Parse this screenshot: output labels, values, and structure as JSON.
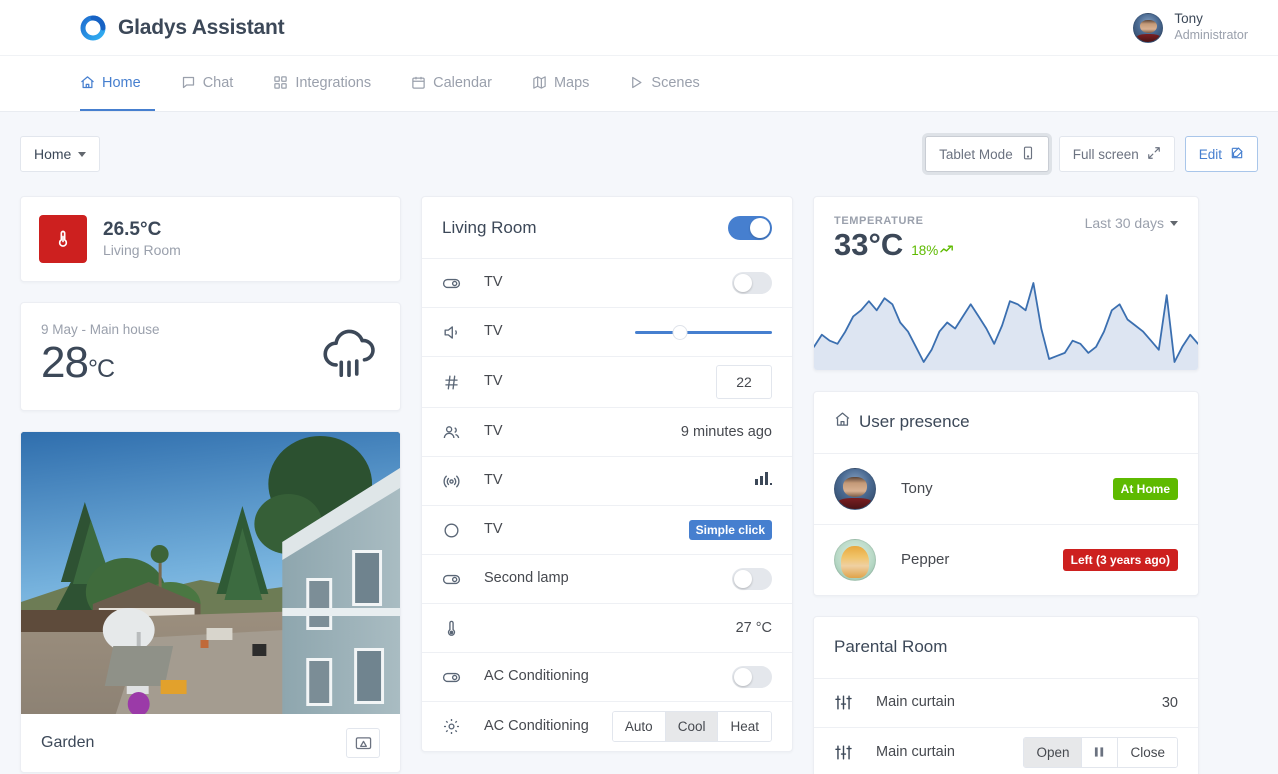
{
  "app": {
    "brand": "Gladys Assistant",
    "logo_icon": "gladys-logo-icon",
    "accent": "#467fcf",
    "danger": "#cd201f",
    "success": "#5eba00"
  },
  "user": {
    "name": "Tony",
    "role": "Administrator",
    "avatar_icon": "avatar-tony"
  },
  "nav": {
    "items": [
      {
        "label": "Home",
        "icon": "home-icon",
        "active": true
      },
      {
        "label": "Chat",
        "icon": "chat-icon",
        "active": false
      },
      {
        "label": "Integrations",
        "icon": "grid-icon",
        "active": false
      },
      {
        "label": "Calendar",
        "icon": "calendar-icon",
        "active": false
      },
      {
        "label": "Maps",
        "icon": "map-icon",
        "active": false
      },
      {
        "label": "Scenes",
        "icon": "play-icon",
        "active": false
      }
    ]
  },
  "toolbar": {
    "dashboard_select": "Home",
    "tablet_mode": "Tablet Mode",
    "full_screen": "Full screen",
    "edit": "Edit"
  },
  "left": {
    "temp_tile": {
      "value": "26.5°C",
      "room": "Living Room",
      "icon": "thermometer-icon"
    },
    "weather": {
      "date": "9 May - Main house",
      "temp": "28",
      "unit": "°C",
      "icon": "rain-cloud-icon"
    },
    "camera": {
      "name": "Garden",
      "action_icon": "cast-icon"
    }
  },
  "living_room": {
    "title": "Living Room",
    "master_on": true,
    "rows": [
      {
        "icon": "switch-icon",
        "label": "TV",
        "control": "toggle",
        "value": "off"
      },
      {
        "icon": "volume-icon",
        "label": "TV",
        "control": "slider",
        "value": "33"
      },
      {
        "icon": "hash-icon",
        "label": "TV",
        "control": "number",
        "value": "22"
      },
      {
        "icon": "people-icon",
        "label": "TV",
        "control": "text",
        "value": "9 minutes ago"
      },
      {
        "icon": "broadcast-icon",
        "label": "TV",
        "control": "signal",
        "value": ""
      },
      {
        "icon": "circle-icon",
        "label": "TV",
        "control": "badge",
        "value": "Simple click"
      },
      {
        "icon": "switch-icon",
        "label": "Second lamp",
        "control": "toggle",
        "value": "off"
      },
      {
        "icon": "thermometer-icon",
        "label": "",
        "control": "text",
        "value": "27 °C"
      },
      {
        "icon": "switch-icon",
        "label": "AC Conditioning",
        "control": "toggle",
        "value": "off"
      },
      {
        "icon": "gear-icon",
        "label": "AC Conditioning",
        "control": "segment",
        "options": [
          "Auto",
          "Cool",
          "Heat"
        ],
        "selected": "Cool"
      }
    ]
  },
  "chart_card": {
    "kicker": "TEMPERATURE",
    "value": "33°C",
    "delta": "18%",
    "delta_icon": "trend-up-icon",
    "range": "Last 30 days"
  },
  "chart_data": {
    "type": "area",
    "title": "TEMPERATURE",
    "xlabel": "",
    "ylabel": "",
    "ylim": [
      0,
      40
    ],
    "grid": false,
    "legend": "none",
    "series_color": "#3b6fb0",
    "fill_color": "#dde5f2",
    "x": [
      1,
      2,
      3,
      4,
      5,
      6,
      7,
      8,
      9,
      10,
      11,
      12,
      13,
      14,
      15,
      16,
      17,
      18,
      19,
      20,
      21,
      22,
      23,
      24,
      25,
      26,
      27,
      28,
      29,
      30,
      31,
      32,
      33,
      34,
      35,
      36,
      37,
      38,
      39,
      40,
      41,
      42,
      43,
      44,
      45,
      46,
      47,
      48,
      49,
      50
    ],
    "values": [
      12,
      16,
      14,
      13,
      17,
      22,
      24,
      27,
      24,
      28,
      26,
      20,
      17,
      12,
      7,
      11,
      17,
      20,
      18,
      22,
      26,
      22,
      18,
      13,
      19,
      27,
      26,
      24,
      33,
      18,
      8,
      9,
      10,
      14,
      13,
      10,
      12,
      17,
      24,
      26,
      21,
      19,
      17,
      14,
      11,
      29,
      7,
      12,
      16,
      13
    ]
  },
  "presence": {
    "title": "User presence",
    "icon": "home-outline-icon",
    "rows": [
      {
        "name": "Tony",
        "status": "At Home",
        "status_type": "home",
        "avatar_icon": "avatar-tony"
      },
      {
        "name": "Pepper",
        "status": "Left (3 years ago)",
        "status_type": "away",
        "avatar_icon": "avatar-pepper"
      }
    ]
  },
  "parental_room": {
    "title": "Parental Room",
    "rows": [
      {
        "icon": "sliders-icon",
        "label": "Main curtain",
        "control": "text",
        "value": "30"
      },
      {
        "icon": "sliders-icon",
        "label": "Main curtain",
        "control": "segment",
        "options": [
          "Open",
          "",
          "Close"
        ],
        "selected": "Open",
        "middle_icon": "pause-icon"
      }
    ]
  }
}
